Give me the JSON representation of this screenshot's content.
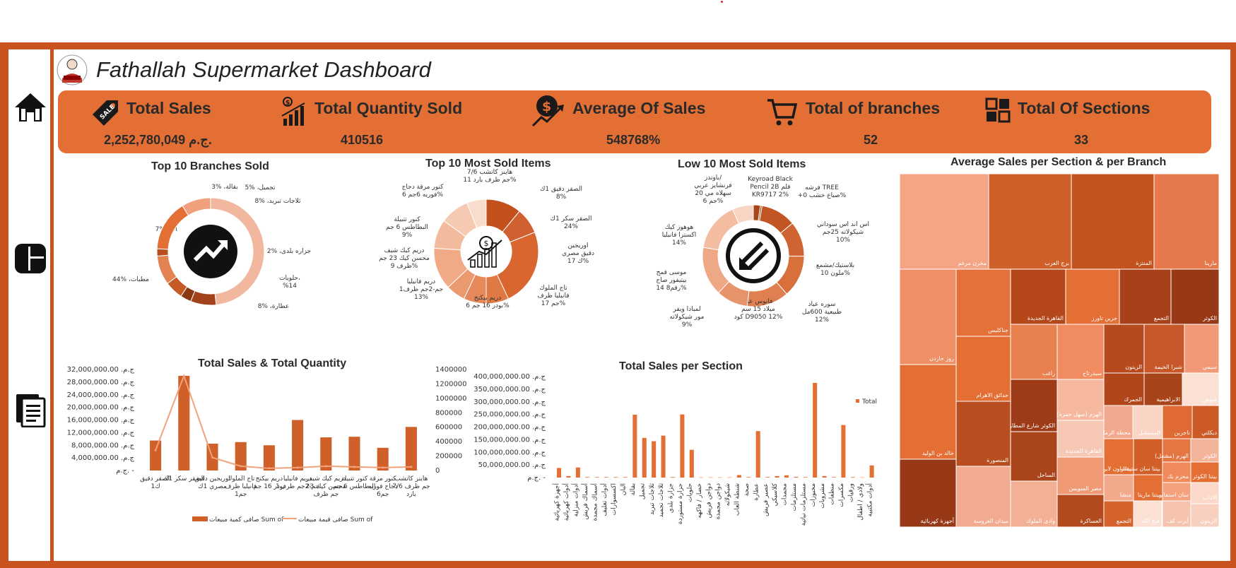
{
  "dashboard": {
    "title": "Fathallah Supermarket Dashboard"
  },
  "kpis": {
    "total_sales": {
      "label": "Total Sales",
      "value": "2,252,780,049 ج.م."
    },
    "total_qty": {
      "label": "Total Quantity Sold",
      "value": "410516"
    },
    "avg_sales": {
      "label": "Average Of Sales",
      "value": "548768%"
    },
    "branches": {
      "label": "Total of branches",
      "value": "52"
    },
    "sections": {
      "label": "Total Of Sections",
      "value": "33"
    }
  },
  "icons": {
    "nav": [
      "home-icon",
      "dashboard-icon",
      "documents-icon"
    ],
    "kpi": [
      "sale-tag-icon",
      "bar-growth-icon",
      "dollar-growth-icon",
      "cart-icon",
      "grid-icon"
    ]
  },
  "colors": {
    "frame": "#c9531f",
    "accent": "#e46f34",
    "bar": "#d0602a",
    "line": "#f0a27a"
  },
  "chart_data": [
    {
      "id": "donut_branches",
      "type": "pie",
      "title": "Top 10 Branches Sold",
      "slices": [
        {
          "label": "مطبات، %44",
          "value": 44,
          "color": "#f2b79f"
        },
        {
          "label": "منظفات، %7",
          "value": 7,
          "color": "#a2421a"
        },
        {
          "label": "بقالة، %3",
          "value": 3,
          "color": "#8a3814"
        },
        {
          "label": "تجميل، %5",
          "value": 5,
          "color": "#c65a26"
        },
        {
          "label": "ثلاجات تبريد، %8",
          "value": 8,
          "color": "#e48352"
        },
        {
          "label": "جزاره بلدى، %2",
          "value": 2,
          "color": "#b84e1e"
        },
        {
          "label": "حلويات، %14",
          "value": 14,
          "color": "#e46f34"
        },
        {
          "label": "عطارة، %8",
          "value": 8,
          "color": "#f0a07a"
        }
      ]
    },
    {
      "id": "donut_top_items",
      "type": "pie",
      "title": "Top 10 Most Sold Items",
      "slices": [
        {
          "label": "هاينز كاتشب 7/6 جم ظرف بارد 11%",
          "value": 11,
          "color": "#c3511e"
        },
        {
          "label": "الصقر دقيق 1ك 8%",
          "value": 8,
          "color": "#cf6030"
        },
        {
          "label": "الصقر سكر 1ك 24%",
          "value": 24,
          "color": "#d9662e"
        },
        {
          "label": "اوريجين دقيق مصري 1ك 7%",
          "value": 7,
          "color": "#e07a44"
        },
        {
          "label": "تاج الملوك فانيليا ظرف 1جم 7%",
          "value": 7,
          "color": "#e6895a"
        },
        {
          "label": "دريم بيكنج بودر 16 جم 6%",
          "value": 6,
          "color": "#eb9a70"
        },
        {
          "label": "دريم فانيليا 1جم-2جم ظرف 13%",
          "value": 13,
          "color": "#f0ab86"
        },
        {
          "label": "دريم كيك شيف محسن كيك 23 جم ظرف 9%",
          "value": 9,
          "color": "#f3bb9e"
        },
        {
          "label": "كنور تتبيلة البطاطس 6 جم 9%",
          "value": 9,
          "color": "#f6cab2"
        },
        {
          "label": "كنور مرقة دجاج فوريه 6جم 6%",
          "value": 6,
          "color": "#f9dccc"
        }
      ]
    },
    {
      "id": "donut_low_items",
      "type": "pie",
      "title": "Low 10 Most Sold Items",
      "slices": [
        {
          "label": "Keyroad Black Pencil 2B قلم KR9717 2%",
          "value": 2,
          "color": "#a8441a"
        },
        {
          "label": "فرشه TREE +صباع خشب 0%",
          "value": 0.5,
          "color": "#b34c1e"
        },
        {
          "label": "اس اند اس سوداني شيكولاته 25جم 10%",
          "value": 10,
          "color": "#c25524"
        },
        {
          "label": "بلاستيك/مشمع ملون 10%",
          "value": 10,
          "color": "#cf6432"
        },
        {
          "label": "سوره عياد طبيعية 600مل 12%",
          "value": 12,
          "color": "#d8703c"
        },
        {
          "label": "فانوس عيد ميلاد 15 سم كود D9050 12%",
          "value": 12,
          "color": "#e08050"
        },
        {
          "label": "لمبادا ويفر مور شيكولاته 9%",
          "value": 9,
          "color": "#e8946a"
        },
        {
          "label": "موسى قمح بيتيفور صاج رقم8 14%",
          "value": 14,
          "color": "#eea886"
        },
        {
          "label": "هوهوز كيك اكسترا فانيليا 14%",
          "value": 14,
          "color": "#f3bda2"
        },
        {
          "label": "باوندز/ فرنشايز عربي سهلاه مي 20 جم 6%",
          "value": 6,
          "color": "#f8d5c3"
        }
      ]
    },
    {
      "id": "combo_sales_qty",
      "type": "bar",
      "title": "Total Sales & Total Quantity",
      "categories": [
        "الصقر دقيق 1ك",
        "الصقر سكر 1ك",
        "اوريجين دقيق مصري 1ك",
        "تاج الملوك فانيليا ظرف 1جم",
        "دريم بيكنج بودر 16 جم",
        "دريم فانيليا 1جم-2جم ظرف",
        "دريم كيك شيف محسن كيك 23 جم ظرف",
        "كنور تتبيلة البطاطس 6 جم",
        "كنور مرقة دجاج فوريه 6جم",
        "هاينز كاتشب 7/6 جم ظرف بارد"
      ],
      "series": [
        {
          "name": "صافى كمية مبيعات Sum of",
          "axis": "left",
          "type": "bar",
          "values": [
            9500000,
            30000000,
            8500000,
            9000000,
            8000000,
            16000000,
            10500000,
            10700000,
            7200000,
            13800000
          ]
        },
        {
          "name": "صافى قيمة مبيعات Sum of",
          "axis": "right",
          "type": "line",
          "values": [
            280000,
            1310000,
            180000,
            60000,
            30000,
            40000,
            60000,
            50000,
            40000,
            50000
          ]
        }
      ],
      "y_left_ticks": [
        "ج.م. 32,000,000.00",
        "ج.م. 28,000,000.00",
        "ج.م. 24,000,000.00",
        "ج.م. 20,000,000.00",
        "ج.م. 16,000,000.00",
        "ج.م. 12,000,000.00",
        "ج.م. 8,000,000.00",
        "ج.م. 4,000,000.00",
        "ج.م. -"
      ],
      "y_right_ticks": [
        "1400000",
        "1200000",
        "1000000",
        "800000",
        "600000",
        "400000",
        "200000",
        "0"
      ],
      "ylim_left": [
        0,
        32000000
      ],
      "ylim_right": [
        0,
        1400000
      ],
      "legend": "bottom"
    },
    {
      "id": "sales_per_section",
      "type": "bar",
      "title": "Total Sales per Section",
      "categories": [
        "أجهزة كهربائية",
        "أدوات كهربائية",
        "أدوات منزلية",
        "أسماك فريش",
        "أسماك مجمدة",
        "أدوات تغليف",
        "اكسسوارات",
        "البان",
        "بقالة",
        "تجميل",
        "ثلاجات تبريد",
        "ثلاجات تجميد",
        "جزارة بلدى",
        "جزارة مستوردة",
        "حلويات",
        "خضار / فاكهه",
        "دواجن فريش",
        "دواجن مجمدة",
        "شيكولاته",
        "شنطة العاب",
        "صحة",
        "عطارة",
        "عصير فريش",
        "كلاسيكي",
        "مجمدات",
        "مستلزمات",
        "مستلزمات نباتية",
        "مخبوزات",
        "مشروبات",
        "منظفات",
        "مكسرات",
        "ورقيات",
        "ولادي / اطفال",
        "أدوات مكتبية"
      ],
      "series": [
        {
          "name": "Total",
          "values": [
            38000000,
            6000000,
            40000000,
            2000000,
            2000000,
            2000000,
            2000000,
            2000000,
            249000000,
            157000000,
            144000000,
            166000000,
            2000000,
            250000000,
            110000000,
            1000000,
            1000000,
            1000000,
            1000000,
            10000000,
            2000000,
            184000000,
            2000000,
            6000000,
            9000000,
            3000000,
            2000000,
            375000000,
            6000000,
            2000000,
            208000000,
            2000000,
            1000000,
            48000000
          ]
        }
      ],
      "y_ticks": [
        "ج.م. 400,000,000.00",
        "ج.م. 350,000,000.00",
        "ج.م. 300,000,000.00",
        "ج.م. 250,000,000.00",
        "ج.م. 200,000,000.00",
        "ج.م. 150,000,000.00",
        "ج.م. 100,000,000.00",
        "ج.م. 50,000,000.00",
        "ج.م. -"
      ],
      "ylim": [
        0,
        400000000
      ],
      "legend": "right"
    },
    {
      "id": "treemap",
      "type": "heatmap",
      "title": "Average Sales per Section & per Branch",
      "cells": [
        {
          "label": "مخزن مرغم",
          "color": "#f3a586"
        },
        {
          "label": "برج العرب",
          "color": "#d0602a"
        },
        {
          "label": "المنتزة",
          "color": "#c2531f"
        },
        {
          "label": "مارينا",
          "color": "#e6794b"
        },
        {
          "label": "روز جاردن",
          "color": "#ee8f66"
        },
        {
          "label": "جناكليس",
          "color": "#e4703a"
        },
        {
          "label": "القاهرة الجديدة",
          "color": "#b5471b"
        },
        {
          "label": "جرين تاورز",
          "color": "#e46f34"
        },
        {
          "label": "التجمع",
          "color": "#a8401a"
        },
        {
          "label": "الكوثر",
          "color": "#973816"
        },
        {
          "label": "راغب",
          "color": "#e98050"
        },
        {
          "label": "سيدرتاح",
          "color": "#f08c60"
        },
        {
          "label": "الزيتون",
          "color": "#b64a1c"
        },
        {
          "label": "شبرا الخيمة",
          "color": "#c8572a"
        },
        {
          "label": "سيمي",
          "color": "#f29a78"
        },
        {
          "label": "حدائق الاهرام",
          "color": "#e46f34"
        },
        {
          "label": "الهرم (سهل حمزة)",
          "color": "#f6b9a0"
        },
        {
          "label": "الجمرك",
          "color": "#b04619"
        },
        {
          "label": "الابراهيمية",
          "color": "#a8441a"
        },
        {
          "label": "فنوش",
          "color": "#fbe0d4"
        },
        {
          "label": "خالد بن الوليد",
          "color": "#e46f34"
        },
        {
          "label": "الكوثر شارع المطار",
          "color": "#9d3c17"
        },
        {
          "label": "محطة الرمل",
          "color": "#f2a98d"
        },
        {
          "label": "المستقبل",
          "color": "#fad4c4"
        },
        {
          "label": "ناجرين",
          "color": "#e06a34"
        },
        {
          "label": "ديكلتي",
          "color": "#cc5a26"
        },
        {
          "label": "المنصورة",
          "color": "#b84e1f"
        },
        {
          "label": "القاهرة الجديدة",
          "color": "#f7c8b6"
        },
        {
          "label": "الساحل",
          "color": "#aa451b"
        },
        {
          "label": "بيتنا اون لاين",
          "color": "#e46f34"
        },
        {
          "label": "بيتنا سان ستيفانو",
          "color": "#d35f28"
        },
        {
          "label": "الهرم (مشعل)",
          "color": "#e47644"
        },
        {
          "label": "الكوثر",
          "color": "#f4b49a"
        },
        {
          "label": "مصر السويس",
          "color": "#f09a76"
        },
        {
          "label": "منشا",
          "color": "#f3a98c"
        },
        {
          "label": "بيتنا ماريتا",
          "color": "#e46f34"
        },
        {
          "label": "محرم بك",
          "color": "#f08a5a"
        },
        {
          "label": "بيتنا الكوثر",
          "color": "#e46f34"
        },
        {
          "label": "فتح الله",
          "color": "#fbe0d4"
        },
        {
          "label": "سان استفانو",
          "color": "#f4a17e"
        },
        {
          "label": "أجهزة كهربائية",
          "color": "#973816"
        },
        {
          "label": "ميدان العروسة",
          "color": "#f2ab90"
        },
        {
          "label": "وادى الملوك",
          "color": "#f3b095"
        },
        {
          "label": "العساكرة",
          "color": "#b24a1e"
        },
        {
          "label": "التجمع",
          "color": "#d4632c"
        },
        {
          "label": "بيتنا التجمع",
          "color": "#e46f34"
        },
        {
          "label": "أيزت كف",
          "color": "#f6c3ad"
        },
        {
          "label": "الاداب",
          "color": "#fbd8ca"
        },
        {
          "label": "الزيتون",
          "color": "#f8d0c0"
        }
      ]
    }
  ]
}
